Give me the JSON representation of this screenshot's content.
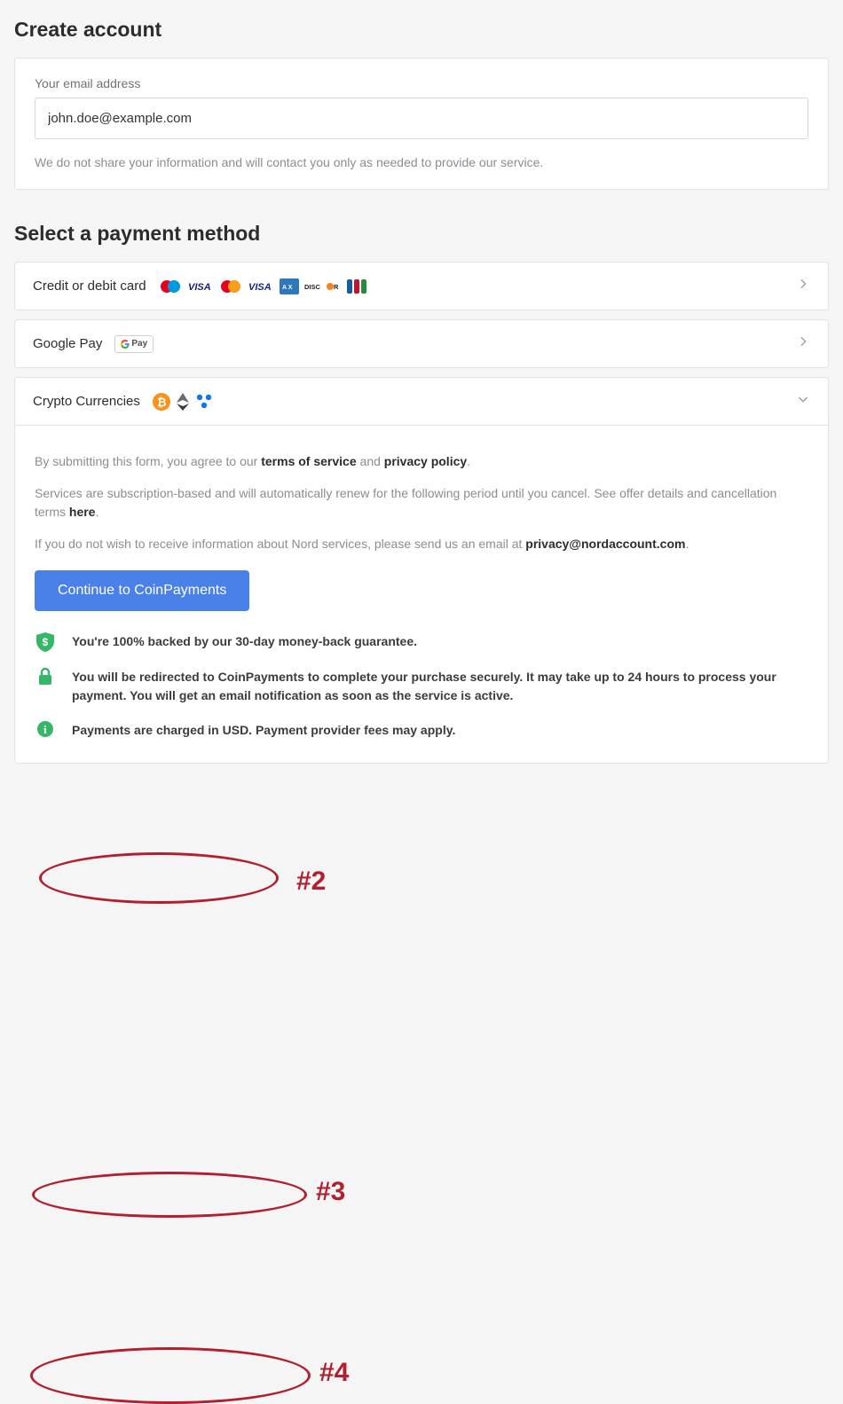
{
  "create": {
    "title": "Create account",
    "email_label": "Your email address",
    "email_value": "john.doe@example.com",
    "helper": "We do not share your information and will contact you only as needed to provide our service."
  },
  "payment": {
    "title": "Select a payment method",
    "options": [
      {
        "label": "Credit or debit card"
      },
      {
        "label": "Google Pay"
      },
      {
        "label": "Crypto Currencies"
      }
    ],
    "crypto_body": {
      "legal1_pre": "By submitting this form, you agree to our ",
      "tos": "terms of service",
      "legal1_mid": " and ",
      "privacy": "privacy policy",
      "legal1_post": ".",
      "legal2_pre": "Services are subscription-based and will automatically renew for the following period until you cancel. See offer details and cancellation terms ",
      "here": "here",
      "legal2_post": ".",
      "legal3_pre": "If you do not wish to receive information about Nord services, please send us an email at ",
      "contact": "privacy@nordaccount.com",
      "legal3_post": ".",
      "cta": "Continue to CoinPayments",
      "trust": [
        "You're 100% backed by our 30-day money-back guarantee.",
        "You will be redirected to CoinPayments to complete your purchase securely. It may take up to 24 hours to process your payment. You will get an email notification as soon as the service is active.",
        "Payments are charged in USD. Payment provider fees may apply."
      ]
    }
  },
  "annotations": {
    "a2": "#2",
    "a3": "#3",
    "a4": "#4"
  }
}
